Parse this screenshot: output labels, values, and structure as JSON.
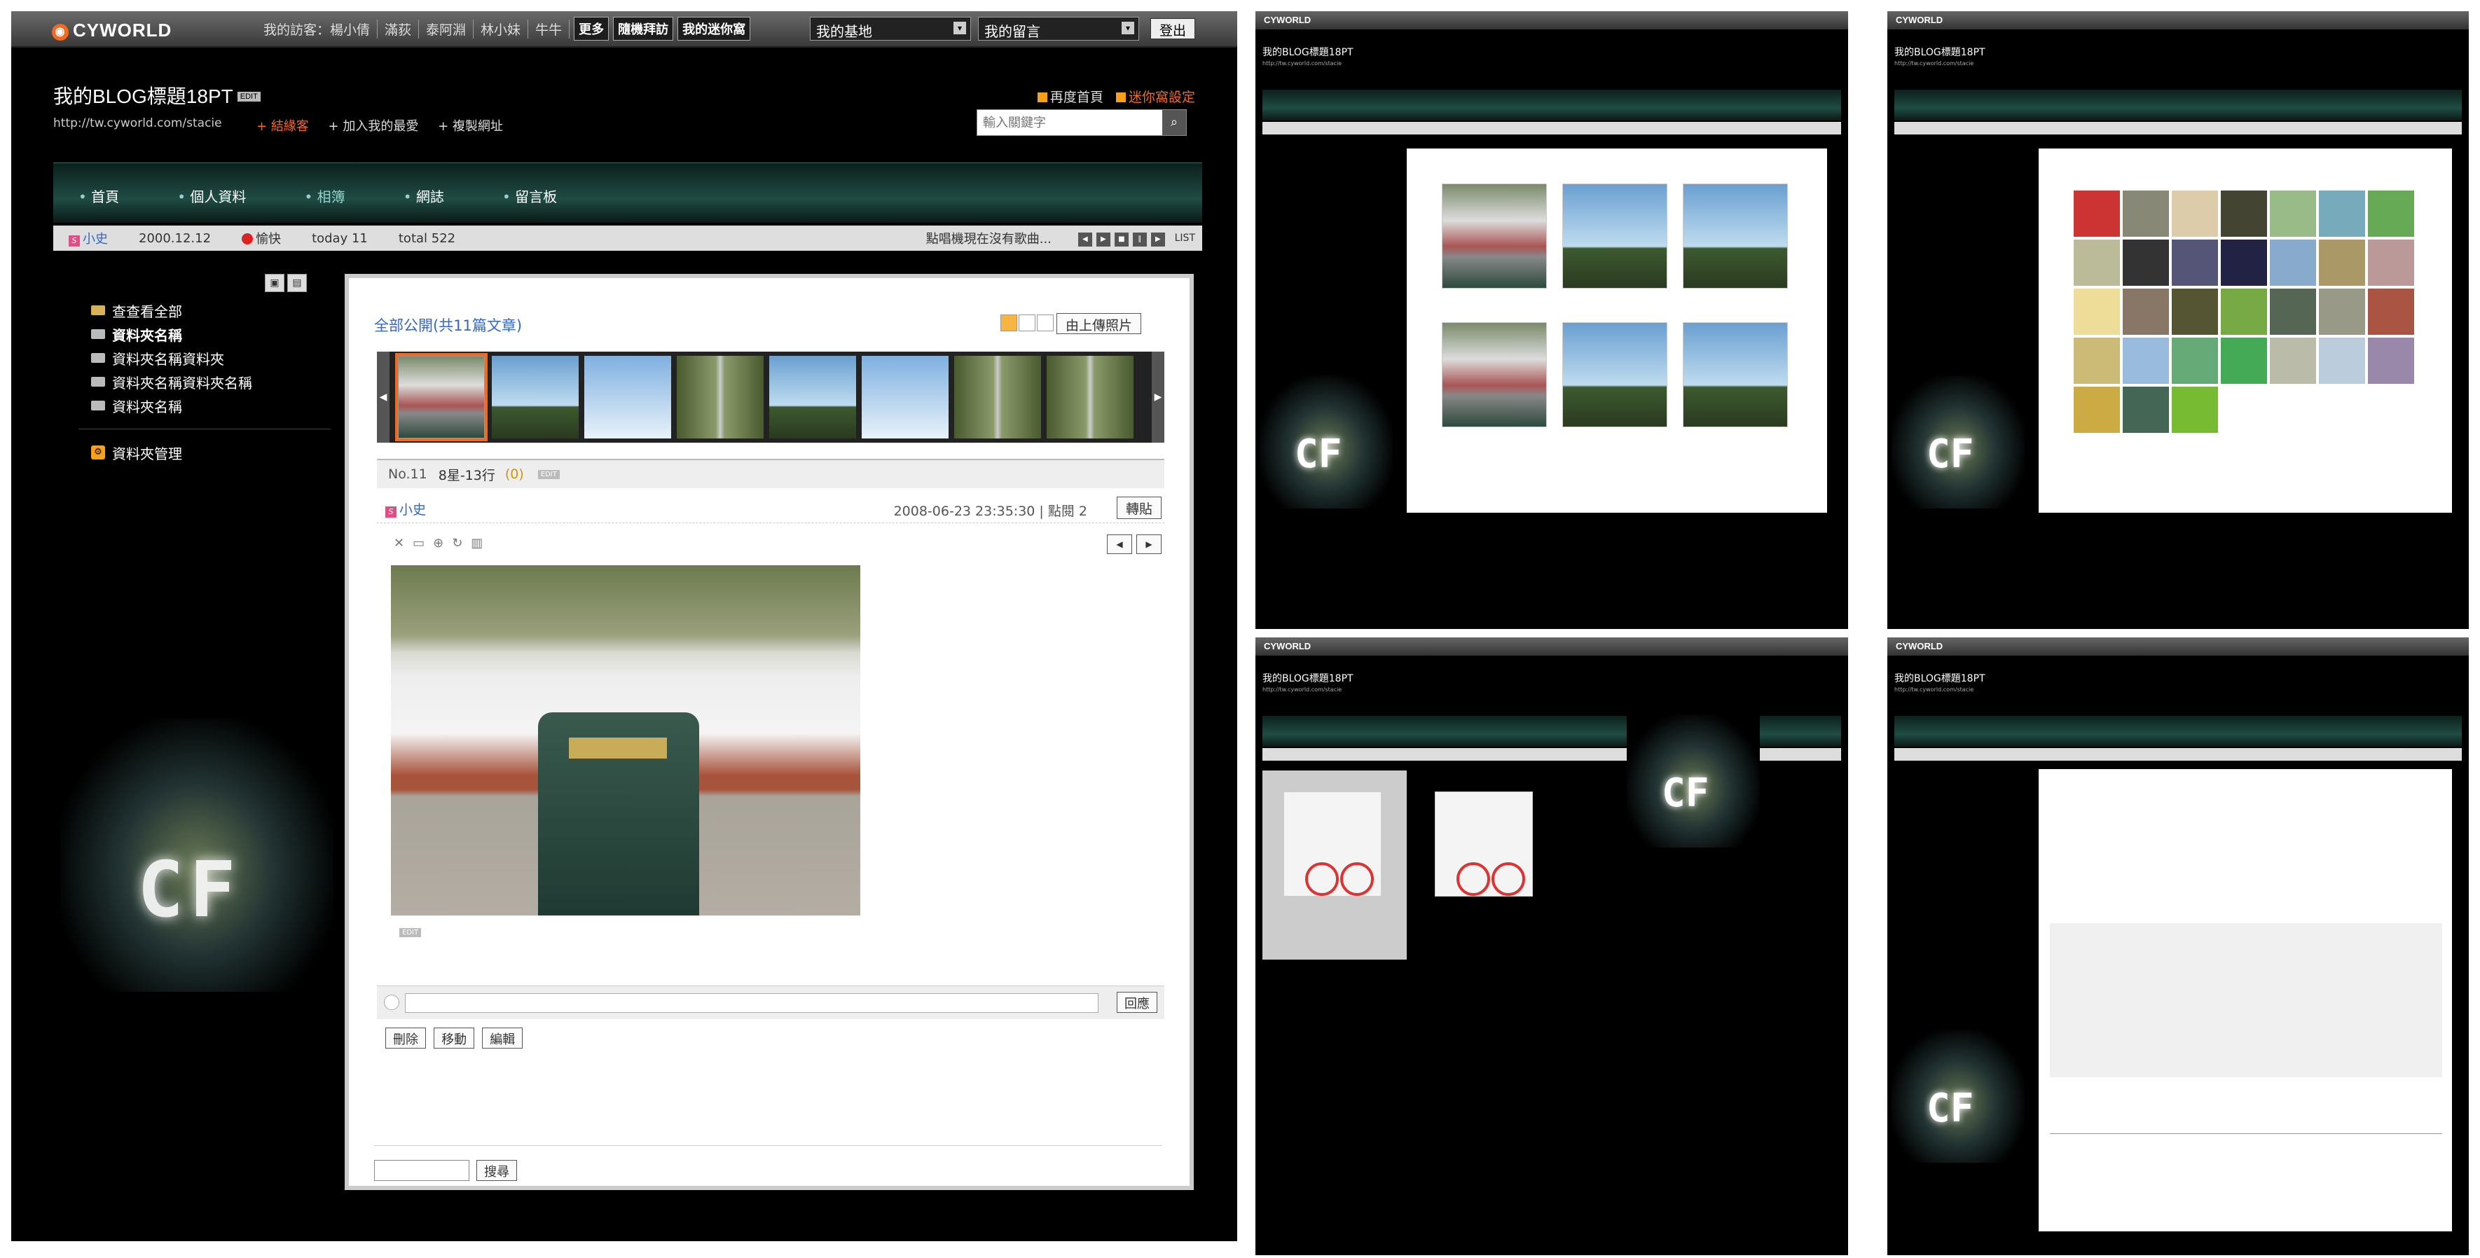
{
  "app": {
    "logo": "CYWORLD"
  },
  "topbar": {
    "visitors": [
      "我的訪客：楊小倩",
      "滿荻",
      "泰阿淵",
      "林小妹",
      "牛牛"
    ],
    "more": "更多",
    "random_visit": "隨機拜訪",
    "my_nest": "我的迷你窩",
    "select_base": "我的基地",
    "select_msg": "我的留言",
    "logout": "登出"
  },
  "header": {
    "blog_title": "我的BLOG標題18PT",
    "edit_tag": "EDIT",
    "url": "http://tw.cyworld.com/stacie",
    "links": [
      "結緣客",
      "加入我的最愛",
      "複製網址"
    ],
    "top_links": [
      "再度首頁",
      "迷你窩設定"
    ],
    "search_placeholder": "輸入關鍵字"
  },
  "menu": {
    "items": [
      "首頁",
      "個人資料",
      "相簿",
      "網誌",
      "留言板"
    ]
  },
  "infobar": {
    "owner": "小史",
    "date": "2000.12.12",
    "mood": "愉快",
    "today": "today 11",
    "total": "total 522",
    "music": "點唱機現在沒有歌曲...",
    "list": "LIST"
  },
  "sidebar": {
    "items": [
      "查查看全部",
      "資料夾名稱",
      "資料夾名稱資料夾",
      "資料夾名稱資料夾名稱",
      "資料夾名稱"
    ],
    "manage": "資料夾管理"
  },
  "album": {
    "title": "全部公開(共11篇文章)",
    "upload": "由上傳照片",
    "post_no": "No.11",
    "post_title": "8星-13行",
    "post_count": "(0)",
    "post_tag": "EDIT",
    "author": "小史",
    "datetime": "2008-06-23 23:35:30",
    "hits": "點閱 2",
    "repost": "轉貼",
    "edit_tag": "EDIT",
    "reply_btn": "回應",
    "actions": [
      "刪除",
      "移動",
      "編輯"
    ],
    "search_btn": "搜尋"
  },
  "mini": {
    "title": "我的BLOG標題18PT",
    "url": "http://tw.cyworld.com/stacie"
  },
  "colors": {
    "accent": "#f26a22",
    "menu": "#1f4c44",
    "link": "#3366cc"
  }
}
